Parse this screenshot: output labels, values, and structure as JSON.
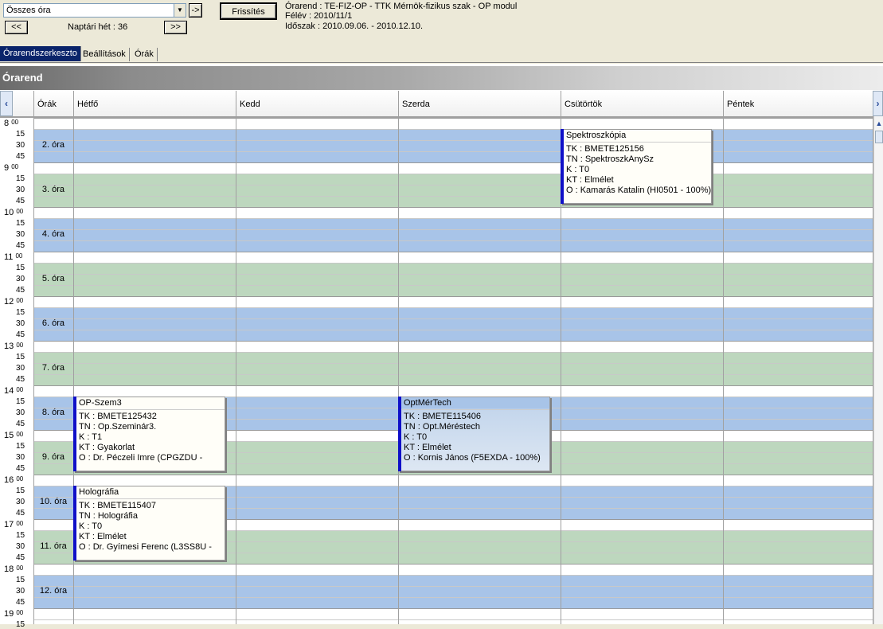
{
  "toolbar": {
    "combo_value": "Összes óra",
    "go_label": "->",
    "refresh_label": "Frissítés",
    "prev_label": "<<",
    "next_label": ">>",
    "week_label": "Naptári hét : 36"
  },
  "info": {
    "line1": "Órarend : TE-FIZ-OP - TTK Mérnök-fizikus szak - OP modul",
    "line2": "Félév : 2010/11/1",
    "line3": "Időszak : 2010.09.06. - 2010.12.10."
  },
  "tabs": [
    {
      "label": "Órarendszerkeszto",
      "active": true
    },
    {
      "label": "Beállítások",
      "active": false
    },
    {
      "label": "Órák",
      "active": false
    }
  ],
  "panel_title": "Órarend",
  "columns": {
    "lessons": "Órák",
    "days": [
      "Hétfő",
      "Kedd",
      "Szerda",
      "Csütörtök",
      "Péntek"
    ]
  },
  "hours": [
    "8",
    "9",
    "10",
    "11",
    "12",
    "13",
    "14",
    "15",
    "16",
    "17",
    "18",
    "19"
  ],
  "minute_labels": [
    "00",
    "15",
    "30",
    "45"
  ],
  "lessons": [
    "2. óra",
    "3. óra",
    "4. óra",
    "5. óra",
    "6. óra",
    "7. óra",
    "8. óra",
    "9. óra",
    "10. óra",
    "11. óra",
    "12. óra"
  ],
  "cards": [
    {
      "title": "Spektroszkópia",
      "lines": [
        "TK : BMETE125156",
        "TN : SpektroszkAnySz",
        "K : T0",
        "KT : Elmélet",
        "O :  Kamarás Katalin (HI0501 - 100%)"
      ]
    },
    {
      "title": "OP-Szem3",
      "lines": [
        "TK : BMETE125432",
        "TN : Op.Szeminár3.",
        "K : T1",
        "KT : Gyakorlat",
        "O :  Dr. Péczeli Imre (CPGZDU -"
      ]
    },
    {
      "title": "OptMérTech",
      "lines": [
        "TK : BMETE115406",
        "TN : Opt.Méréstech",
        "K : T0",
        "KT : Elmélet",
        "O :  Kornis János (F5EXDA - 100%)"
      ]
    },
    {
      "title": "Holográfia",
      "lines": [
        "TK : BMETE115407",
        "TN : Holográfia",
        "K : T0",
        "KT : Elmélet",
        "O :  Dr. Gyímesi Ferenc (L3SS8U -"
      ]
    }
  ],
  "colors": {
    "band_blue": "#a8c4e8",
    "band_green": "#bdd7be",
    "card_bar": "#1010c8",
    "tab_active": "#0a246a"
  }
}
